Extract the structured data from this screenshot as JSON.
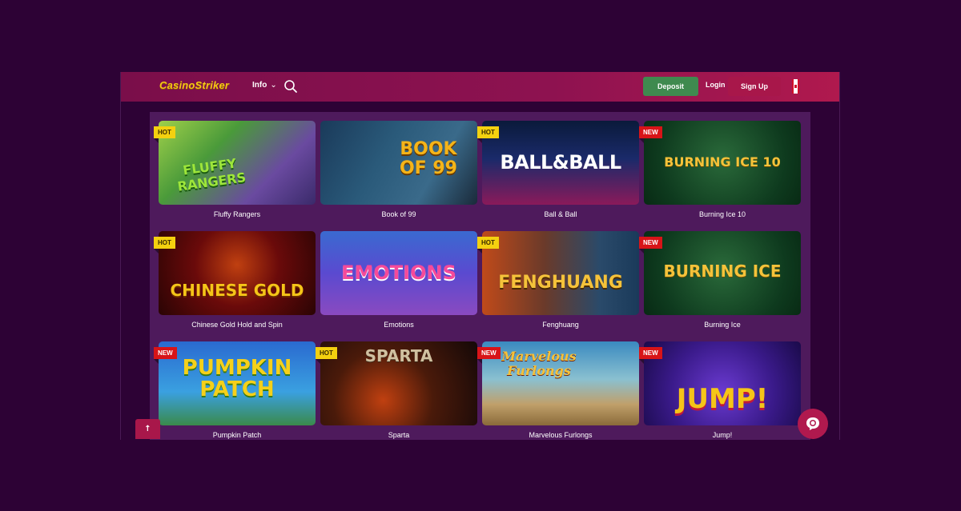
{
  "header": {
    "logo": "CasinoStriker",
    "info_label": "Info",
    "deposit_label": "Deposit",
    "login_label": "Login",
    "signup_label": "Sign Up",
    "flag_icon": "canada-flag-icon"
  },
  "games": [
    {
      "title": "Fluffy Rangers",
      "badge": "HOT",
      "art": "FLUFFY RANGERS"
    },
    {
      "title": "Book of 99",
      "badge": "",
      "art": "BOOK OF 99"
    },
    {
      "title": "Ball & Ball",
      "badge": "HOT",
      "art": "BALL&BALL"
    },
    {
      "title": "Burning Ice 10",
      "badge": "NEW",
      "art": "BURNING ICE 10"
    },
    {
      "title": "Chinese Gold Hold and Spin",
      "badge": "HOT",
      "art": "CHINESE GOLD"
    },
    {
      "title": "Emotions",
      "badge": "",
      "art": "EMOTIONS"
    },
    {
      "title": "Fenghuang",
      "badge": "HOT",
      "art": "FENGHUANG"
    },
    {
      "title": "Burning Ice",
      "badge": "NEW",
      "art": "BURNING ICE"
    },
    {
      "title": "Pumpkin Patch",
      "badge": "NEW",
      "art": "PUMPKIN PATCH"
    },
    {
      "title": "Sparta",
      "badge": "HOT",
      "art": "SPARTA"
    },
    {
      "title": "Marvelous Furlongs",
      "badge": "NEW",
      "art": "Marvelous Furlongs"
    },
    {
      "title": "Jump!",
      "badge": "NEW",
      "art": "JUMP!"
    }
  ],
  "scroll_top_label": "↑",
  "colors": {
    "background": "#2d0235",
    "content": "#4e1a5c",
    "deposit": "#3f8a4f",
    "signup": "#a8174a",
    "logo": "#f5c518",
    "hot_badge": "#f4d10f",
    "new_badge": "#d81418"
  }
}
